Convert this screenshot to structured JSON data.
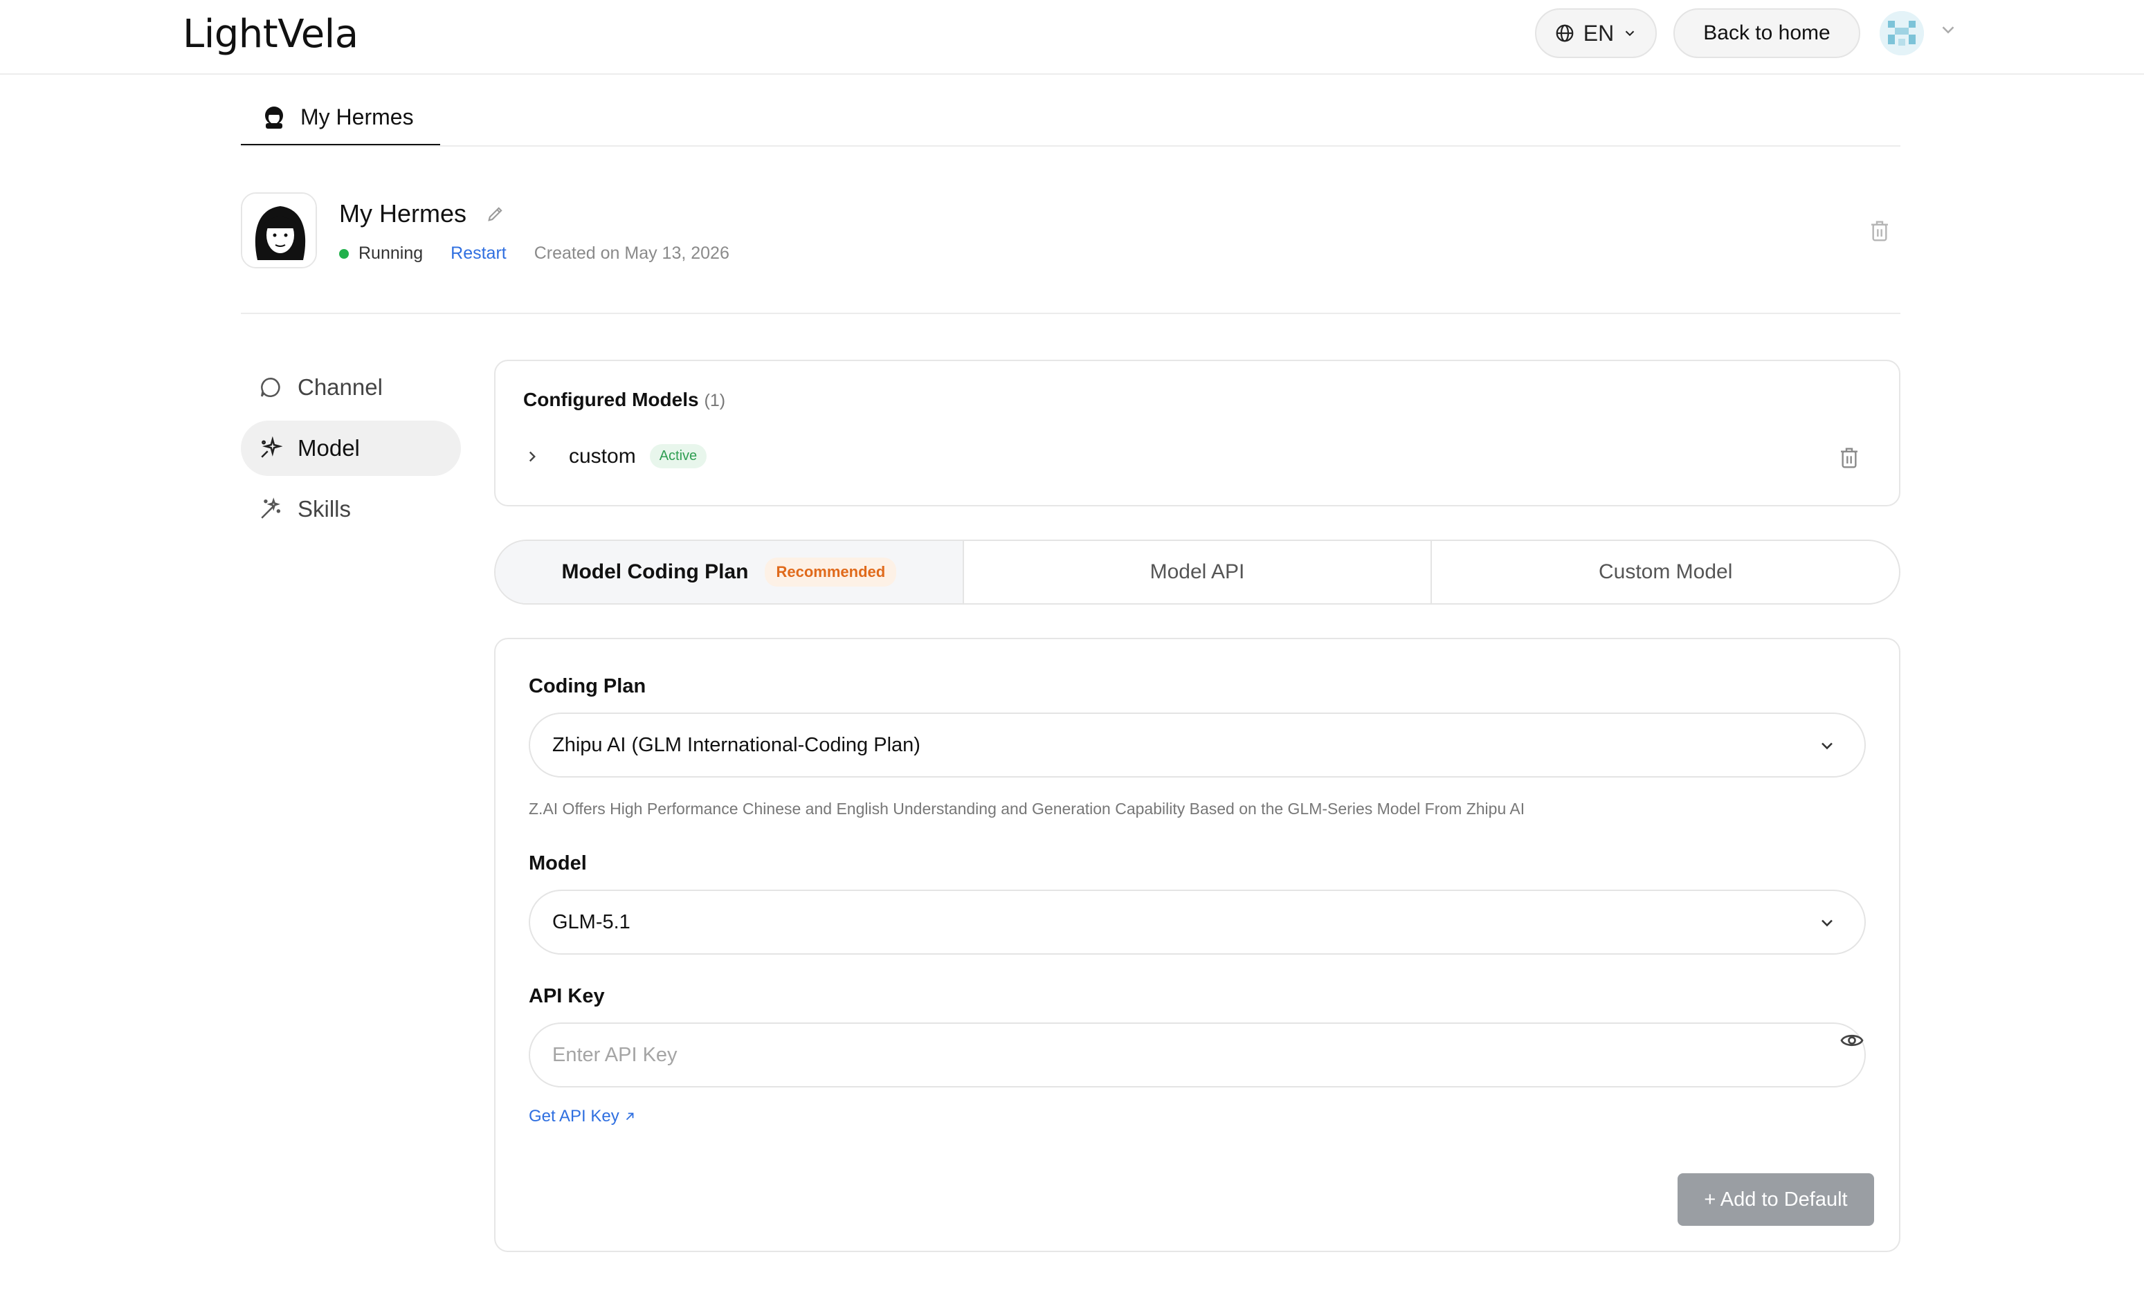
{
  "header": {
    "logo": "LightVela",
    "language": "EN",
    "back_home": "Back to home"
  },
  "page_tab": {
    "label": "My Hermes"
  },
  "agent": {
    "name": "My Hermes",
    "status": "Running",
    "restart": "Restart",
    "created": "Created on May 13, 2026"
  },
  "sidebar": {
    "items": [
      {
        "label": "Channel",
        "icon": "chat-bubble-icon"
      },
      {
        "label": "Model",
        "icon": "sparkle-icon",
        "active": true
      },
      {
        "label": "Skills",
        "icon": "magic-wand-icon"
      }
    ]
  },
  "configured_models": {
    "title": "Configured Models",
    "count": "(1)",
    "items": [
      {
        "name": "custom",
        "badge": "Active"
      }
    ]
  },
  "model_tabs": [
    {
      "label": "Model Coding Plan",
      "badge": "Recommended",
      "active": true
    },
    {
      "label": "Model API"
    },
    {
      "label": "Custom Model"
    }
  ],
  "form": {
    "coding_plan_label": "Coding Plan",
    "coding_plan_value": "Zhipu AI (GLM International-Coding Plan)",
    "coding_plan_hint": "Z.AI Offers High Performance Chinese and English Understanding and Generation Capability Based on the GLM-Series Model From Zhipu AI",
    "model_label": "Model",
    "model_value": "GLM-5.1",
    "api_key_label": "API Key",
    "api_key_placeholder": "Enter API Key",
    "api_key_value": "",
    "get_api_key": "Get API Key",
    "add_button": "+ Add to Default"
  },
  "colors": {
    "running": "#22b14c",
    "link": "#2f6fe0",
    "active_badge": "#2f9e52",
    "recommended_badge": "#e06a1b",
    "add_button_bg": "#9a9ea3"
  }
}
